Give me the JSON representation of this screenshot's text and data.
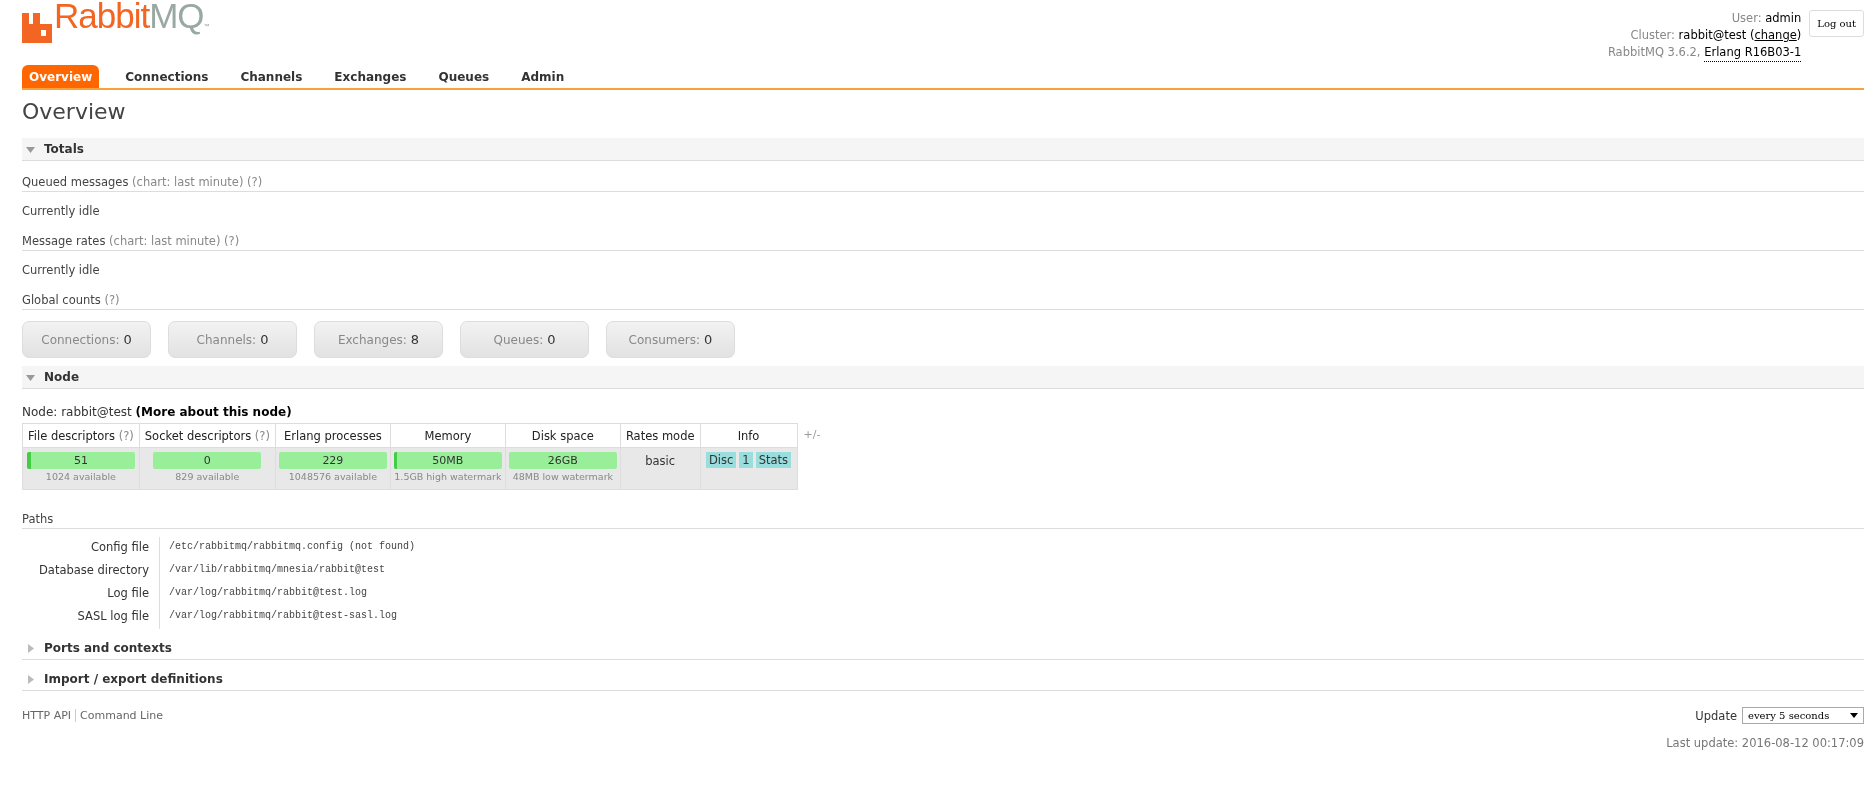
{
  "logo": {
    "brand": "Rabbit",
    "suffix": "MQ",
    "mark": "™"
  },
  "user_info": {
    "user_label": "User:",
    "user": "admin",
    "cluster_label": "Cluster:",
    "cluster": "rabbit@test",
    "paren_open": "(",
    "change_link": "change",
    "paren_close": ")",
    "version": "RabbitMQ 3.6.2,",
    "erlang": "Erlang R16B03-1"
  },
  "logout_button": "Log out",
  "tabs": [
    {
      "label": "Overview",
      "selected": true
    },
    {
      "label": "Connections",
      "selected": false
    },
    {
      "label": "Channels",
      "selected": false
    },
    {
      "label": "Exchanges",
      "selected": false
    },
    {
      "label": "Queues",
      "selected": false
    },
    {
      "label": "Admin",
      "selected": false
    }
  ],
  "page_title": "Overview",
  "totals": {
    "title": "Totals",
    "expanded": true,
    "subsections": [
      {
        "title": "Queued messages",
        "note": "(chart: last minute)",
        "help": "(?)",
        "content": "Currently idle"
      },
      {
        "title": "Message rates",
        "note": "(chart: last minute)",
        "help": "(?)",
        "content": "Currently idle"
      }
    ],
    "global_counts": {
      "title": "Global counts",
      "help": "(?)"
    },
    "counters": [
      {
        "label": "Connections:",
        "value": "0"
      },
      {
        "label": "Channels:",
        "value": "0"
      },
      {
        "label": "Exchanges:",
        "value": "8"
      },
      {
        "label": "Queues:",
        "value": "0"
      },
      {
        "label": "Consumers:",
        "value": "0"
      }
    ]
  },
  "node": {
    "title": "Node",
    "expanded": true,
    "node_label": "Node: rabbit@test",
    "more_link": "(More about this node)",
    "columns": [
      {
        "label": "File descriptors",
        "help": "(?)"
      },
      {
        "label": "Socket descriptors",
        "help": "(?)"
      },
      {
        "label": "Erlang processes"
      },
      {
        "label": "Memory"
      },
      {
        "label": "Disk space"
      },
      {
        "label": "Rates mode"
      },
      {
        "label": "Info"
      }
    ],
    "toggle_columns": "+/-",
    "meters": [
      {
        "value": "51",
        "level": 0.04,
        "caption": "1024 available"
      },
      {
        "value": "0",
        "caption": "829 available"
      },
      {
        "value": "229",
        "caption": "1048576 available"
      },
      {
        "value": "50MB",
        "level": 0.03,
        "caption": "1.5GB high watermark"
      },
      {
        "value": "26GB",
        "caption": "48MB low watermark"
      }
    ],
    "rates_mode": "basic",
    "info_badges": [
      "Disc",
      "1",
      "Stats"
    ],
    "paths": {
      "title": "Paths",
      "rows": [
        {
          "label": "Config file",
          "value": "/etc/rabbitmq/rabbitmq.config (not found)"
        },
        {
          "label": "Database directory",
          "value": "/var/lib/rabbitmq/mnesia/rabbit@test"
        },
        {
          "label": "Log file",
          "value": "/var/log/rabbitmq/rabbit@test.log"
        },
        {
          "label": "SASL log file",
          "value": "/var/log/rabbitmq/rabbit@test-sasl.log"
        }
      ]
    }
  },
  "collapsed_sections": [
    {
      "title": "Ports and contexts",
      "expanded": false
    },
    {
      "title": "Import / export definitions",
      "expanded": false
    }
  ],
  "footer": {
    "links": [
      "HTTP API",
      "Command Line"
    ],
    "update_label": "Update",
    "update_value": "every 5 seconds",
    "last_update": "Last update: 2016-08-12 00:17:09"
  }
}
